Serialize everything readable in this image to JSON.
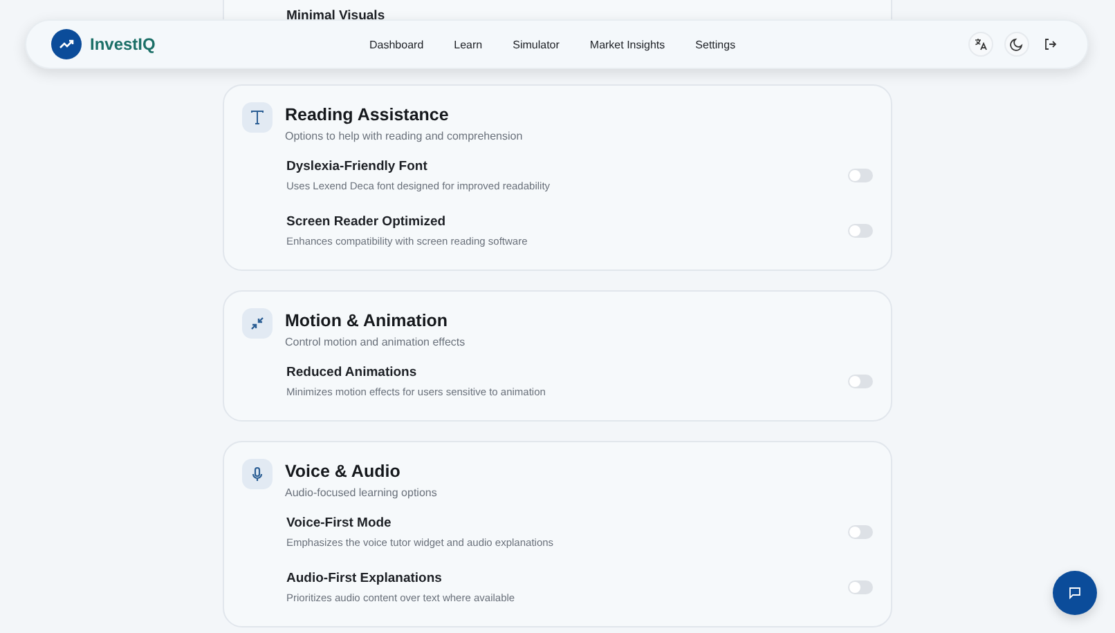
{
  "nav": {
    "brand": "InvestIQ",
    "links": [
      {
        "label": "Dashboard"
      },
      {
        "label": "Learn"
      },
      {
        "label": "Simulator"
      },
      {
        "label": "Market Insights"
      },
      {
        "label": "Settings"
      }
    ]
  },
  "partial_section": {
    "settings": [
      {
        "title": "Minimal Visuals"
      }
    ]
  },
  "sections": [
    {
      "kind": "text",
      "title": "Reading Assistance",
      "subtitle": "Options to help with reading and comprehension",
      "settings": [
        {
          "title": "Dyslexia-Friendly Font",
          "description": "Uses Lexend Deca font designed for improved readability",
          "on": false
        },
        {
          "title": "Screen Reader Optimized",
          "description": "Enhances compatibility with screen reading software",
          "on": false
        }
      ]
    },
    {
      "kind": "minimize",
      "title": "Motion & Animation",
      "subtitle": "Control motion and animation effects",
      "settings": [
        {
          "title": "Reduced Animations",
          "description": "Minimizes motion effects for users sensitive to animation",
          "on": false
        }
      ]
    },
    {
      "kind": "mic",
      "title": "Voice & Audio",
      "subtitle": "Audio-focused learning options",
      "settings": [
        {
          "title": "Voice-First Mode",
          "description": "Emphasizes the voice tutor widget and audio explanations",
          "on": false
        },
        {
          "title": "Audio-First Explanations",
          "description": "Prioritizes audio content over text where available",
          "on": false
        }
      ]
    }
  ]
}
